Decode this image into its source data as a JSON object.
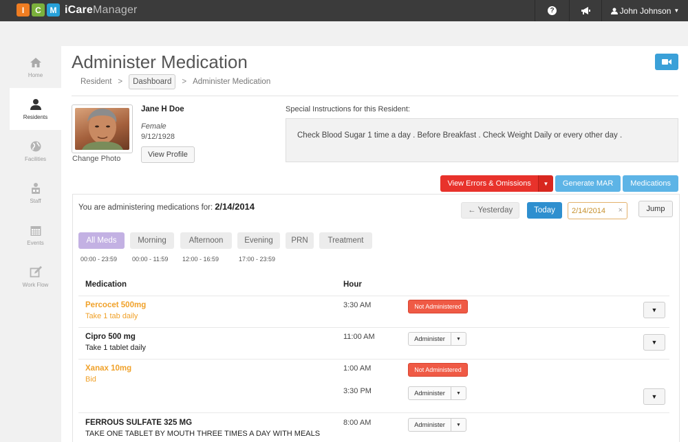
{
  "app": {
    "logo_letters": [
      "I",
      "C",
      "M"
    ],
    "logo_colors": [
      "#ef7d22",
      "#7bb13c",
      "#27a1d9"
    ],
    "brand_bold": "iCare",
    "brand_light": "Manager"
  },
  "topnav": {
    "help_icon": "question-circle-icon",
    "announce_icon": "bullhorn-icon",
    "user_name": "John Johnson"
  },
  "sidebar": {
    "items": [
      {
        "label": "Home",
        "icon": "home-icon"
      },
      {
        "label": "Residents",
        "icon": "user-icon",
        "active": true
      },
      {
        "label": "Facilities",
        "icon": "globe-icon"
      },
      {
        "label": "Staff",
        "icon": "staff-icon"
      },
      {
        "label": "Events",
        "icon": "calendar-icon"
      },
      {
        "label": "Work Flow",
        "icon": "edit-icon"
      }
    ]
  },
  "page": {
    "title": "Administer Medication",
    "breadcrumb": [
      "Resident",
      "Dashboard",
      "Administer Medication"
    ]
  },
  "resident": {
    "name": "Jane H Doe",
    "gender": "Female",
    "dob": "9/12/1928",
    "change_photo": "Change Photo",
    "view_profile": "View Profile",
    "instructions_label": "Special Instructions for this Resident:",
    "instructions": "Check Blood Sugar 1 time a day . Before Breakfast . Check Weight Daily or every other day ."
  },
  "actions": {
    "errors": "View Errors & Omissions",
    "generate_mar": "Generate MAR",
    "medications": "Medications"
  },
  "schedule": {
    "label": "You are administering medications for:",
    "date": "2/14/2014",
    "yesterday": "← Yesterday",
    "today": "Today",
    "date_input": "2/14/2014",
    "clear": "×",
    "jump": "Jump",
    "filters": [
      "All Meds",
      "Morning",
      "Afternoon",
      "Evening",
      "PRN",
      "Treatment"
    ],
    "ranges": [
      "00:00 - 23:59",
      "00:00 - 11:59",
      "12:00 - 16:59",
      "17:00 - 23:59"
    ]
  },
  "table": {
    "col_medication": "Medication",
    "col_hour": "Hour",
    "not_administered": "Not Administered",
    "administer": "Administer",
    "rows": [
      {
        "name": "Percocet 500mg",
        "instructions": "Take 1 tab daily",
        "hours": [
          "3:30 AM"
        ],
        "status": [
          "not_administered"
        ]
      },
      {
        "name": "Cipro 500 mg",
        "instructions": "Take 1 tablet daily",
        "hours": [
          "11:00 AM"
        ],
        "status": [
          "administer"
        ]
      },
      {
        "name": "Xanax 10mg",
        "instructions": "Bid",
        "hours": [
          "1:00 AM",
          "3:30 PM"
        ],
        "status": [
          "not_administered",
          "administer"
        ]
      },
      {
        "name": "FERROUS SULFATE 325 MG",
        "instructions": "TAKE ONE TABLET BY MOUTH THREE TIMES A DAY WITH MEALS",
        "hours": [
          "8:00 AM"
        ],
        "status": [
          "administer"
        ]
      }
    ]
  }
}
